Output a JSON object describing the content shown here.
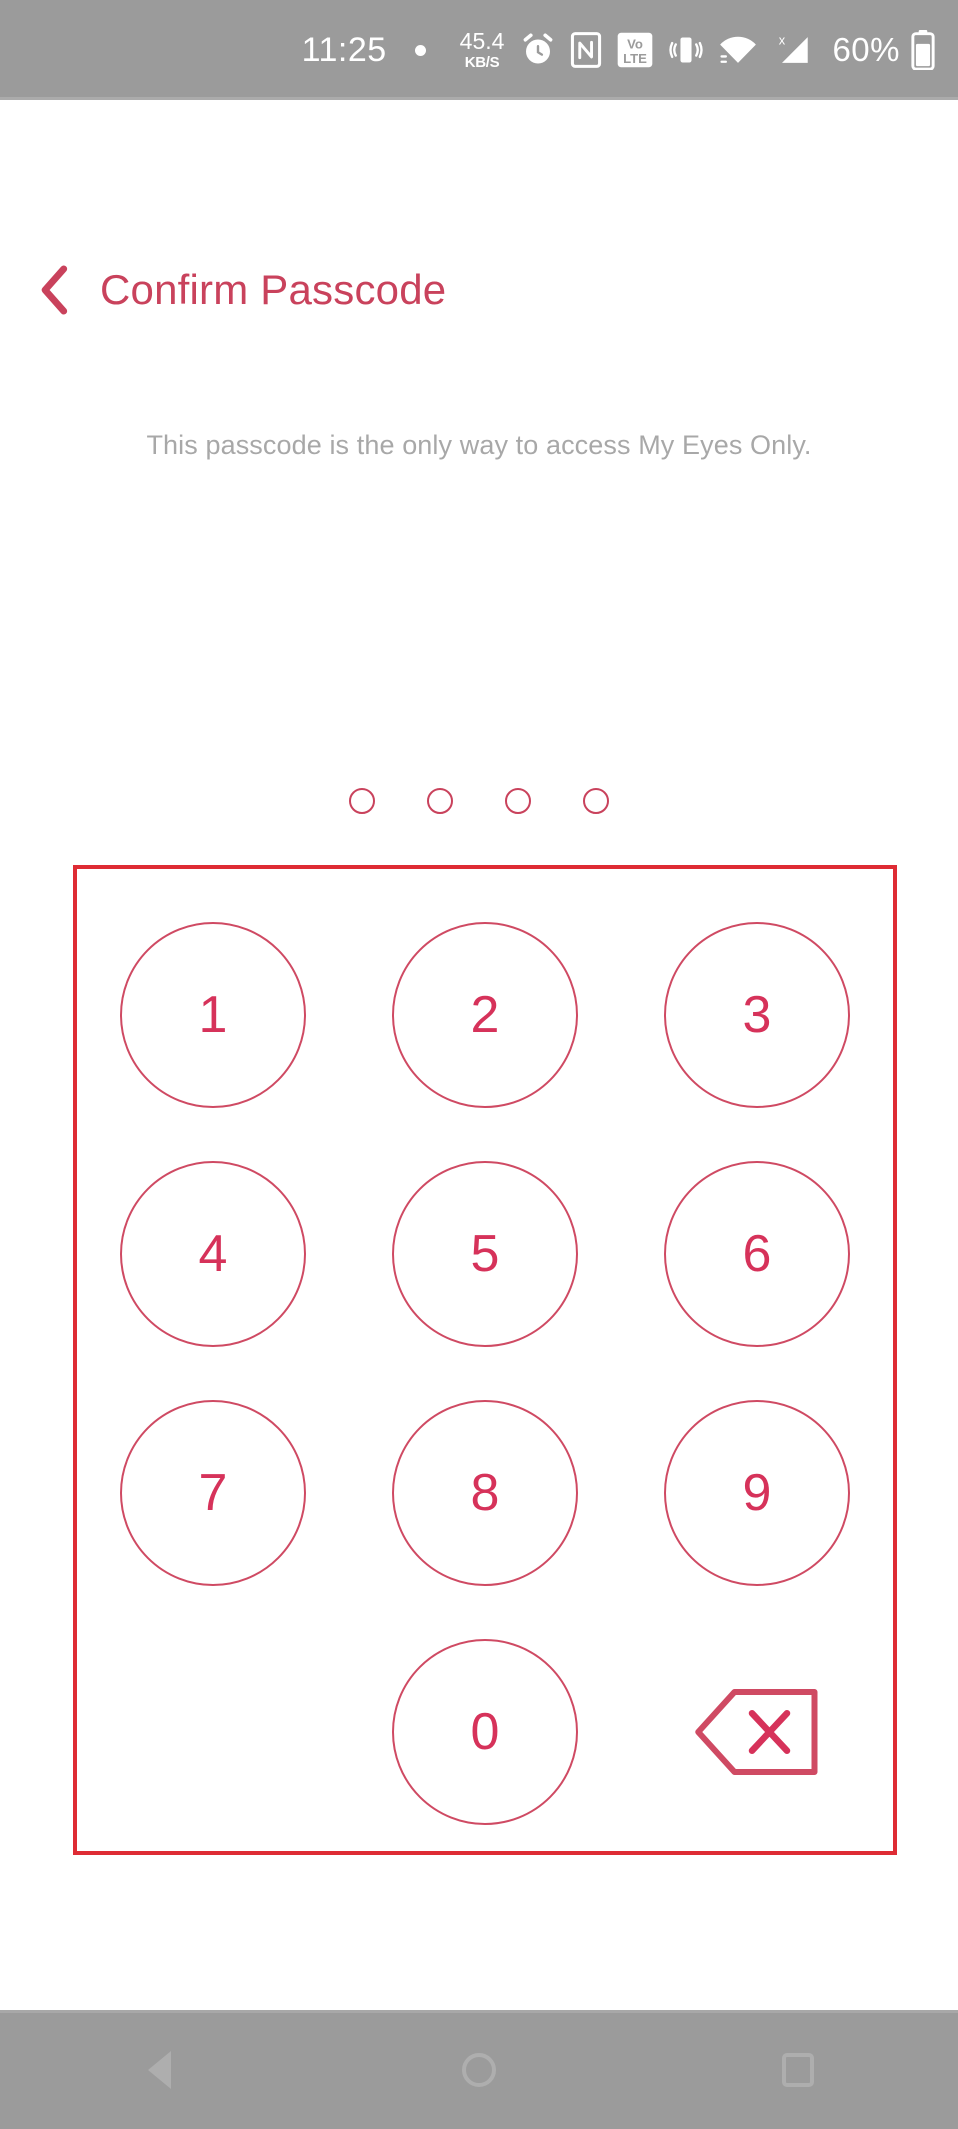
{
  "status_bar": {
    "time": "11:25",
    "dot_icon": "dot-indicator-icon",
    "network_speed_value": "45.4",
    "network_speed_unit": "KB/S",
    "icons": [
      "alarm-clock-icon",
      "nfc-icon",
      "volte-icon",
      "vibrate-icon",
      "wifi-icon",
      "cellular-signal-no-sim-icon"
    ],
    "volte_label_top": "Vo",
    "volte_label_bottom": "LTE",
    "battery_percent": "60%",
    "battery_icon": "battery-icon",
    "background_color": "#9b9b9b"
  },
  "header": {
    "back_icon": "back-chevron-icon",
    "title": "Confirm Passcode",
    "title_color": "#c9425c"
  },
  "body": {
    "subtitle": "This passcode is the only way to access My Eyes Only.",
    "subtitle_color": "#a8a8a8"
  },
  "passcode": {
    "length": 4,
    "entered_count": 0,
    "dot_color": "#c9425c"
  },
  "keypad": {
    "border_color": "#de2b34",
    "key_border_color": "#cf4a63",
    "key_text_color": "#d6325a",
    "rows": [
      [
        {
          "label": "1",
          "name": "key-1"
        },
        {
          "label": "2",
          "name": "key-2"
        },
        {
          "label": "3",
          "name": "key-3"
        }
      ],
      [
        {
          "label": "4",
          "name": "key-4"
        },
        {
          "label": "5",
          "name": "key-5"
        },
        {
          "label": "6",
          "name": "key-6"
        }
      ],
      [
        {
          "label": "7",
          "name": "key-7"
        },
        {
          "label": "8",
          "name": "key-8"
        },
        {
          "label": "9",
          "name": "key-9"
        }
      ]
    ],
    "bottom_row": {
      "blank_label": "",
      "zero_label": "0",
      "delete_icon": "backspace-delete-icon"
    }
  },
  "nav_bar": {
    "back_icon": "nav-back-icon",
    "home_icon": "nav-home-icon",
    "recents_icon": "nav-recents-icon",
    "background_color": "#9b9b9b"
  }
}
